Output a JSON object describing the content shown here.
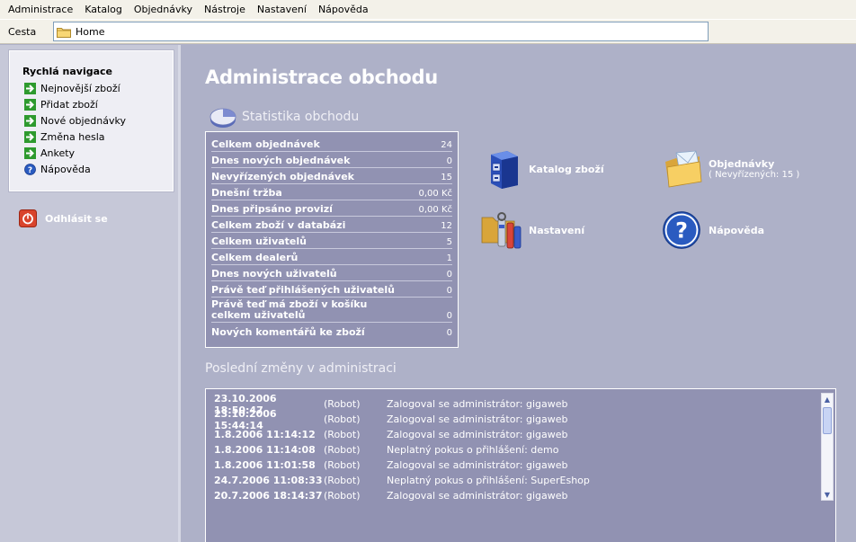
{
  "menu": [
    "Administrace",
    "Katalog",
    "Objednávky",
    "Nástroje",
    "Nastavení",
    "Nápověda"
  ],
  "address": {
    "label": "Cesta",
    "value": "Home"
  },
  "quicknav": {
    "title": "Rychlá navigace",
    "items": [
      {
        "label": "Nejnovější zboží",
        "icon": "green-arrow-icon"
      },
      {
        "label": "Přidat zboží",
        "icon": "green-arrow-icon"
      },
      {
        "label": "Nové objednávky",
        "icon": "green-arrow-icon"
      },
      {
        "label": "Změna hesla",
        "icon": "green-arrow-icon"
      },
      {
        "label": "Ankety",
        "icon": "green-arrow-icon"
      },
      {
        "label": "Nápověda",
        "icon": "help-icon"
      }
    ]
  },
  "logout": {
    "label": "Odhlásit se",
    "icon": "power-icon"
  },
  "page_title": "Administrace obchodu",
  "stats": {
    "title": "Statistika obchodu",
    "rows": [
      {
        "label": "Celkem objednávek",
        "value": "24"
      },
      {
        "label": "Dnes nových objednávek",
        "value": "0"
      },
      {
        "label": "Nevyřízených objednávek",
        "value": "15"
      },
      {
        "label": "Dnešní tržba",
        "value": "0,00 Kč"
      },
      {
        "label": "Dnes připsáno provizí",
        "value": "0,00 Kč"
      },
      {
        "label": "Celkem zboží v databázi",
        "value": "12"
      },
      {
        "label": "Celkem uživatelů",
        "value": "5"
      },
      {
        "label": "Celkem dealerů",
        "value": "1"
      },
      {
        "label": "Dnes nových uživatelů",
        "value": "0"
      },
      {
        "label": "Právě teď přihlášených uživatelů",
        "value": "0"
      },
      {
        "label": "Právě teď má zboží v košíku celkem uživatelů",
        "value": "0"
      },
      {
        "label": "Nových komentářů ke zboží",
        "value": "0"
      }
    ]
  },
  "tiles": {
    "catalog": {
      "label": "Katalog zboží"
    },
    "orders": {
      "label": "Objednávky",
      "sub": "( Nevyřízených: 15 )"
    },
    "settings": {
      "label": "Nastavení"
    },
    "help": {
      "label": "Nápověda"
    }
  },
  "changes": {
    "title": "Poslední změny v administraci",
    "rows": [
      {
        "date": "23.10.2006 18:50:47",
        "who": "(Robot)",
        "msg": "Zalogoval se administrátor: gigaweb"
      },
      {
        "date": "23.10.2006 15:44:14",
        "who": "(Robot)",
        "msg": "Zalogoval se administrátor: gigaweb"
      },
      {
        "date": "1.8.2006 11:14:12",
        "who": "(Robot)",
        "msg": "Zalogoval se administrátor: gigaweb"
      },
      {
        "date": "1.8.2006 11:14:08",
        "who": "(Robot)",
        "msg": "Neplatný pokus o přihlášení: demo"
      },
      {
        "date": "1.8.2006 11:01:58",
        "who": "(Robot)",
        "msg": "Zalogoval se administrátor: gigaweb"
      },
      {
        "date": "24.7.2006 11:08:33",
        "who": "(Robot)",
        "msg": "Neplatný pokus o přihlášení: SuperEshop"
      },
      {
        "date": "20.7.2006 18:14:37",
        "who": "(Robot)",
        "msg": "Zalogoval se administrátor: gigaweb"
      }
    ]
  }
}
